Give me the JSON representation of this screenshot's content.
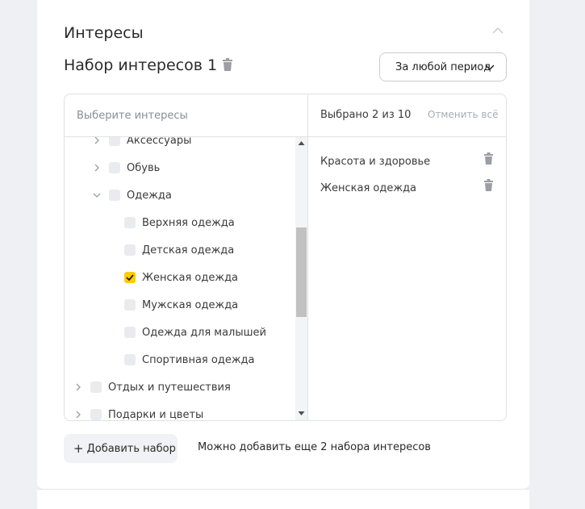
{
  "section": {
    "title": "Интересы"
  },
  "set": {
    "title": "Набор интересов 1"
  },
  "period": {
    "label": "За любой период"
  },
  "search": {
    "placeholder": "Выберите интересы",
    "value": ""
  },
  "tree": {
    "items": [
      {
        "label": "Аксессуары",
        "level": 1,
        "expand": "collapsed",
        "checked": false
      },
      {
        "label": "Обувь",
        "level": 1,
        "expand": "collapsed",
        "checked": false
      },
      {
        "label": "Одежда",
        "level": 1,
        "expand": "expanded",
        "checked": false
      },
      {
        "label": "Верхняя одежда",
        "level": 2,
        "expand": "none",
        "checked": false
      },
      {
        "label": "Детская одежда",
        "level": 2,
        "expand": "none",
        "checked": false
      },
      {
        "label": "Женская одежда",
        "level": 2,
        "expand": "none",
        "checked": true
      },
      {
        "label": "Мужская одежда",
        "level": 2,
        "expand": "none",
        "checked": false
      },
      {
        "label": "Одежда для малышей",
        "level": 2,
        "expand": "none",
        "checked": false
      },
      {
        "label": "Спортивная одежда",
        "level": 2,
        "expand": "none",
        "checked": false
      },
      {
        "label": "Отдых и путешествия",
        "level": 0,
        "expand": "collapsed",
        "checked": false
      },
      {
        "label": "Подарки и цветы",
        "level": 0,
        "expand": "collapsed",
        "checked": false
      }
    ]
  },
  "selected": {
    "count_label": "Выбрано 2 из 10",
    "cancel_all": "Отменить всё",
    "items": [
      {
        "label": "Красота и здоровье"
      },
      {
        "label": "Женская одежда"
      }
    ]
  },
  "footer": {
    "add_button": "Добавить набор",
    "hint": "Можно добавить еще 2 набора интересов"
  },
  "colors": {
    "accent": "#ffcc00",
    "page_bg": "#eef0f3",
    "card_bg": "#ffffff",
    "border": "#dfe1e5",
    "muted_text": "#8a8d93"
  },
  "icons": {
    "collapse": "chevron-up-icon",
    "trash": "trash-icon",
    "dropdown": "chevron-down-icon",
    "expand_collapsed": "chevron-right-icon",
    "expand_expanded": "chevron-down-icon",
    "check": "check-icon",
    "plus": "plus-icon"
  }
}
